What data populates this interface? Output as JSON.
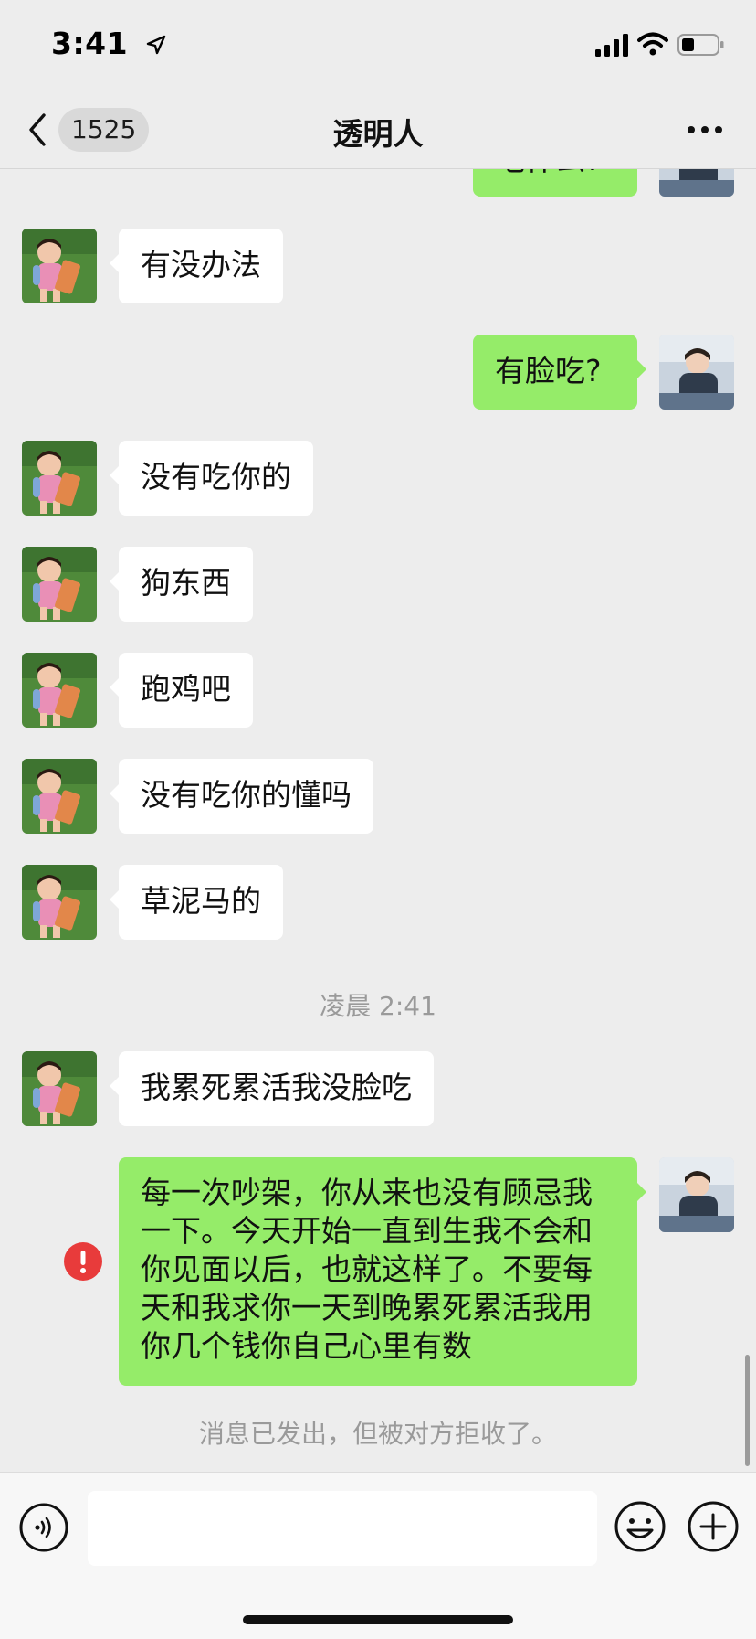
{
  "status_bar": {
    "time": "3:41"
  },
  "header": {
    "back_count": "1525",
    "title": "透明人"
  },
  "messages": [
    {
      "side": "out",
      "text": "吃什么?"
    },
    {
      "side": "in",
      "text": "有没办法"
    },
    {
      "side": "out",
      "text": "有脸吃?"
    },
    {
      "side": "in",
      "text": "没有吃你的"
    },
    {
      "side": "in",
      "text": "狗东西"
    },
    {
      "side": "in",
      "text": "跑鸡吧"
    },
    {
      "side": "in",
      "text": "没有吃你的懂吗"
    },
    {
      "side": "in",
      "text": "草泥马的"
    },
    {
      "side": "in",
      "text": "我累死累活我没脸吃"
    },
    {
      "side": "out",
      "text": "每一次吵架，你从来也没有顾忌我一下。今天开始一直到生我不会和你见面以后，也就这样了。不要每天和我求你一天到晚累死累活我用你几个钱你自己心里有数"
    }
  ],
  "timestamp": "凌晨 2:41",
  "system_note": "消息已发出，但被对方拒收了。",
  "colors": {
    "incoming_bubble": "#ffffff",
    "outgoing_bubble": "#95ec69",
    "background": "#ededed",
    "error": "#e83b3b"
  },
  "icons": [
    "back-chevron-icon",
    "more-dots-icon",
    "voice-icon",
    "emoji-icon",
    "plus-icon",
    "error-icon"
  ]
}
